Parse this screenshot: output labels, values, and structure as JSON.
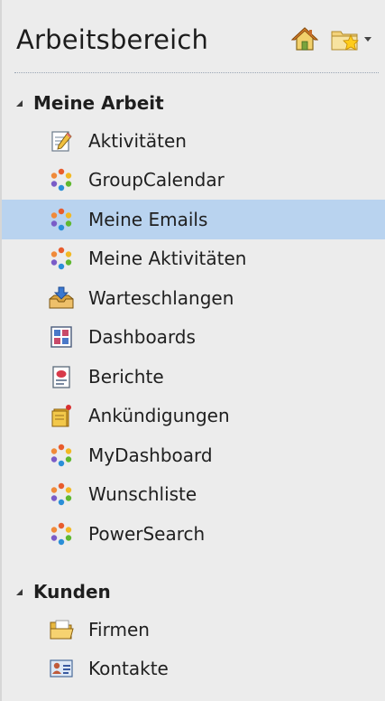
{
  "header": {
    "title": "Arbeitsbereich",
    "home_icon": "home-icon",
    "favorites_icon": "favorites-folder-icon"
  },
  "groups": [
    {
      "title": "Meine Arbeit",
      "expanded": true,
      "items": [
        {
          "label": "Aktivitäten",
          "icon": "activities-icon"
        },
        {
          "label": "GroupCalendar",
          "icon": "custom-entity-icon"
        },
        {
          "label": "Meine Emails",
          "icon": "custom-entity-icon",
          "selected": true
        },
        {
          "label": "Meine Aktivitäten",
          "icon": "custom-entity-icon"
        },
        {
          "label": "Warteschlangen",
          "icon": "queue-icon"
        },
        {
          "label": "Dashboards",
          "icon": "dashboard-icon"
        },
        {
          "label": "Berichte",
          "icon": "report-icon"
        },
        {
          "label": "Ankündigungen",
          "icon": "announcement-icon"
        },
        {
          "label": "MyDashboard",
          "icon": "custom-entity-icon"
        },
        {
          "label": "Wunschliste",
          "icon": "custom-entity-icon"
        },
        {
          "label": "PowerSearch",
          "icon": "custom-entity-icon"
        }
      ]
    },
    {
      "title": "Kunden",
      "expanded": true,
      "items": [
        {
          "label": "Firmen",
          "icon": "folder-icon"
        },
        {
          "label": "Kontakte",
          "icon": "contact-card-icon"
        }
      ]
    }
  ],
  "colors": {
    "background": "#ececec",
    "selected": "#b9d3ef",
    "divider": "#9aa6b4"
  }
}
